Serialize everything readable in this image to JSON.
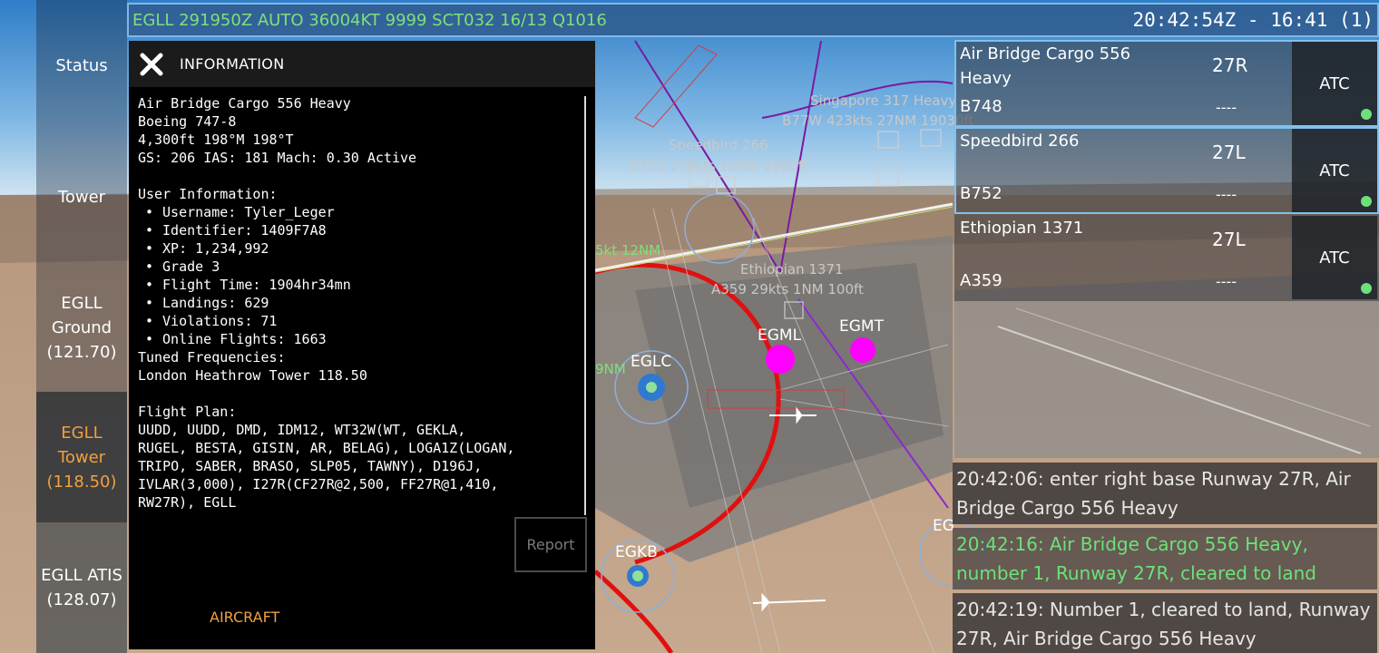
{
  "metar": "EGLL 291950Z AUTO 36004KT 9999 SCT032 16/13 Q1016",
  "clock": "20:42:54Z - 16:41 (1)",
  "nav": {
    "status": "Status",
    "tower": "Tower",
    "ground": [
      "EGLL",
      "Ground",
      "(121.70)"
    ],
    "tower_freq": [
      "EGLL",
      "Tower",
      "(118.50)"
    ],
    "atis": [
      "EGLL ATIS",
      "(128.07)"
    ]
  },
  "info": {
    "title": "INFORMATION",
    "lines": [
      "Air Bridge Cargo 556 Heavy",
      "Boeing 747-8",
      "4,300ft 198°M 198°T",
      "GS: 206 IAS: 181 Mach: 0.30 Active",
      "",
      "User Information:"
    ],
    "user_items": [
      "Username: Tyler_Leger",
      "Identifier: 1409F7A8",
      "XP: 1,234,992",
      "Grade 3",
      "Flight Time: 1904hr34mn",
      "Landings: 629",
      "Violations: 71",
      "Online Flights: 1663"
    ],
    "after": [
      "Tuned Frequencies:",
      "London Heathrow Tower 118.50",
      "",
      "Flight Plan:",
      "UUDD, UUDD, DMD, IDM12, WT32W(WT, GEKLA,",
      "RUGEL, BESTA, GISIN, AR, BELAG), LOGA1Z(LOGAN,",
      "TRIPO, SABER, BRASO, SLP05, TAWNY), D196J,",
      "IVLAR(3,000), I27R(CF27R@2,500, FF27R@1,410,",
      "RW27R), EGLL"
    ],
    "report": "Report",
    "aircraft_tab": "AIRCRAFT"
  },
  "strips": [
    {
      "callsign": "Air Bridge Cargo 556 Heavy",
      "type": "B748",
      "runway": "27R",
      "status": "----",
      "atc": "ATC"
    },
    {
      "callsign": "Speedbird 266",
      "type": "B752",
      "runway": "27L",
      "status": "----",
      "atc": "ATC"
    },
    {
      "callsign": "Ethiopian 1371",
      "type": "A359",
      "runway": "27L",
      "status": "----",
      "atc": "ATC"
    }
  ],
  "log": [
    "20:42:06: enter right base Runway 27R, Air Bridge Cargo 556 Heavy",
    "20:42:16: Air Bridge Cargo 556 Heavy, number 1, Runway 27R, cleared to land",
    "20:42:19: Number 1, cleared to land, Runway 27R, Air Bridge Cargo 556 Heavy"
  ],
  "map": {
    "airports": [
      "EGLC",
      "EGML",
      "EGMT",
      "EGKB",
      "EG"
    ],
    "traffic_labels": [
      "Singapore 317 Heavy",
      "B77W 423kts 27NM 19030ft",
      "Speedbird 266",
      "B752 178kts 10NM 2980ft",
      "Ethiopian 1371",
      "A359 29kts 1NM 100ft",
      "5kt 12NM",
      "9NM"
    ]
  },
  "colors": {
    "metar": "#7ee07a",
    "accent_orange": "#f0a040",
    "active_green": "#6ee07a",
    "airspace_red": "#e01010",
    "airport_magenta": "#ff00ff"
  }
}
